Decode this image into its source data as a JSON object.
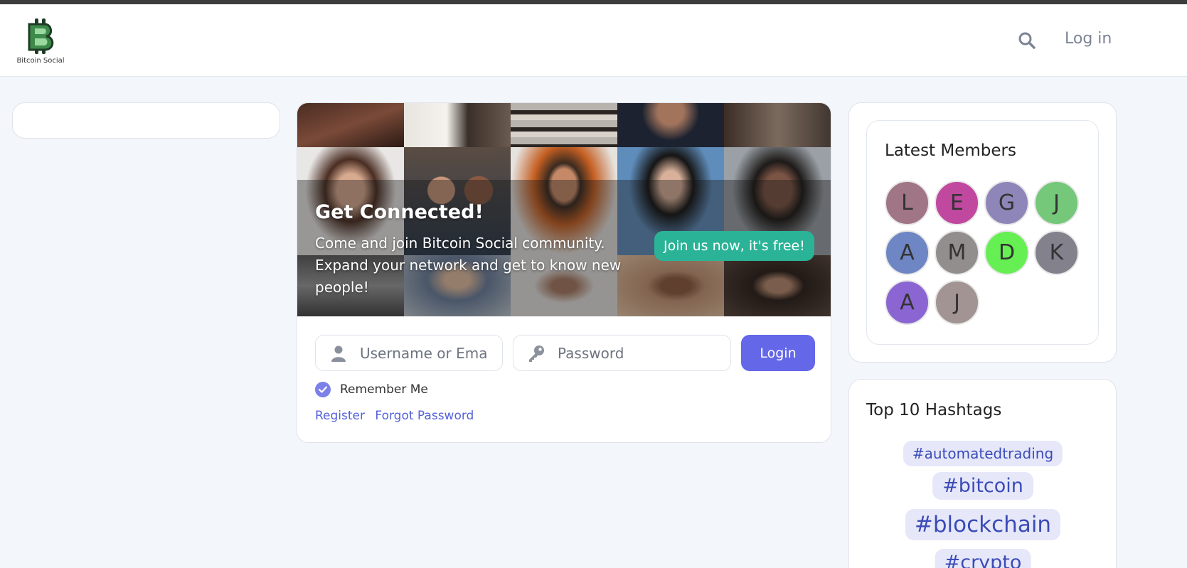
{
  "header": {
    "logo_text": "Bitcoin Social",
    "login_label": "Log in"
  },
  "hero": {
    "title": "Get Connected!",
    "text": "Come and join Bitcoin Social community. Expand your network and get to know new people!",
    "join_button": "Join us now, it's free!"
  },
  "login": {
    "username_placeholder": "Username or Email",
    "password_placeholder": "Password",
    "login_button": "Login",
    "remember_label": "Remember Me",
    "register_link": "Register",
    "forgot_link": "Forgot Password"
  },
  "members": {
    "title": "Latest Members",
    "avatars": [
      {
        "letter": "L",
        "color": "#a07585"
      },
      {
        "letter": "E",
        "color": "#c1489f"
      },
      {
        "letter": "G",
        "color": "#8e86b8"
      },
      {
        "letter": "J",
        "color": "#75c77a"
      },
      {
        "letter": "A",
        "color": "#6e86c4"
      },
      {
        "letter": "M",
        "color": "#938e8e"
      },
      {
        "letter": "D",
        "color": "#66ef52"
      },
      {
        "letter": "K",
        "color": "#83818c"
      },
      {
        "letter": "A",
        "color": "#8b66d2"
      },
      {
        "letter": "J",
        "color": "#a19493"
      }
    ]
  },
  "hashtags": {
    "title": "Top 10 Hashtags",
    "tags": [
      "#automatedtrading",
      "#bitcoin",
      "#blockchain",
      "#crypto"
    ]
  },
  "colors": {
    "accent": "#6367e8",
    "join_green": "#2bb397",
    "link": "#5563d8",
    "background": "#f3f6fb"
  }
}
